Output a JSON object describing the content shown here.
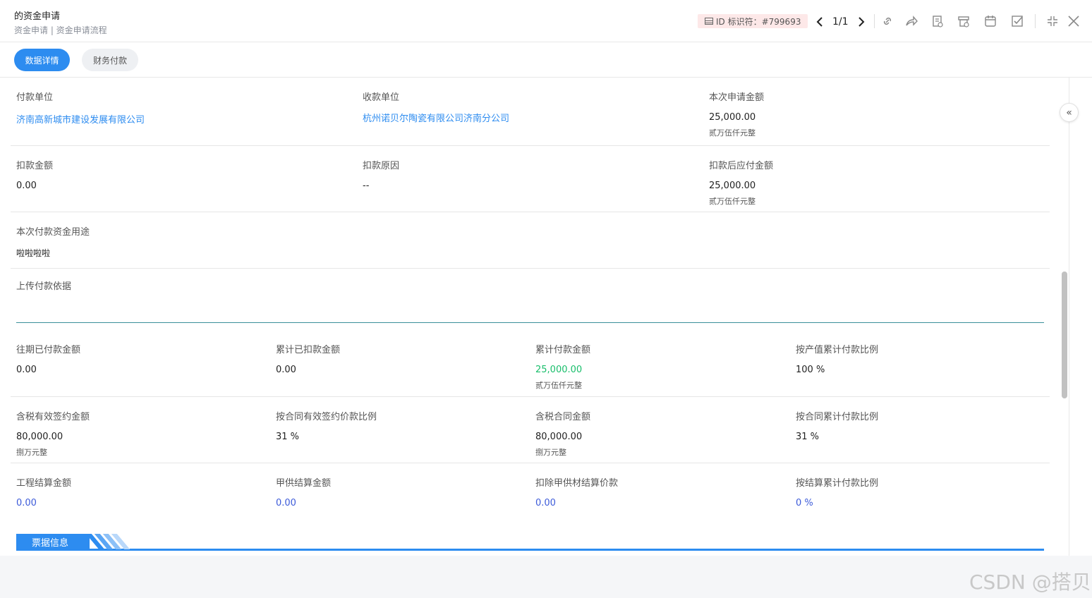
{
  "header": {
    "title": "的资金申请",
    "subtitle": "资金申请 | 资金申请流程",
    "id_label": "ID 标识符：#799693",
    "pager": "1/1"
  },
  "tabs": [
    {
      "label": "数据详情"
    },
    {
      "label": "财务付款"
    }
  ],
  "rows": {
    "r1": {
      "pay_unit_label": "付款单位",
      "pay_unit_value": "济南高新城市建设发展有限公司",
      "recv_unit_label": "收款单位",
      "recv_unit_value": "杭州诺贝尔陶瓷有限公司济南分公司",
      "apply_amount_label": "本次申请金额",
      "apply_amount_value": "25,000.00",
      "apply_amount_caption": "贰万伍仟元整"
    },
    "r2": {
      "deduct_label": "扣款金额",
      "deduct_value": "0.00",
      "reason_label": "扣款原因",
      "reason_value": "--",
      "after_label": "扣款后应付金额",
      "after_value": "25,000.00",
      "after_caption": "贰万伍仟元整"
    },
    "r3": {
      "purpose_label": "本次付款资金用途",
      "purpose_value": "啦啦啦啦"
    },
    "r4": {
      "upload_label": "上传付款依据"
    },
    "r5": {
      "c1_label": "往期已付款金额",
      "c1_value": "0.00",
      "c2_label": "累计已扣款金额",
      "c2_value": "0.00",
      "c3_label": "累计付款金额",
      "c3_value": "25,000.00",
      "c3_caption": "贰万伍仟元整",
      "c4_label": "按产值累计付款比例",
      "c4_value": "100 %"
    },
    "r6": {
      "c1_label": "含税有效签约金额",
      "c1_value": "80,000.00",
      "c1_caption": "捌万元整",
      "c2_label": "按合同有效签约价款比例",
      "c2_value": "31 %",
      "c3_label": "含税合同金额",
      "c3_value": "80,000.00",
      "c3_caption": "捌万元整",
      "c4_label": "按合同累计付款比例",
      "c4_value": "31 %"
    },
    "r7": {
      "c1_label": "工程结算金额",
      "c1_value": "0.00",
      "c2_label": "甲供结算金额",
      "c2_value": "0.00",
      "c3_label": "扣除甲供材结算价款",
      "c3_value": "0.00",
      "c4_label": "按结算累计付款比例",
      "c4_value": "0 %"
    }
  },
  "section": {
    "title": "票据信息"
  },
  "collapse_icon": "«",
  "watermark": "CSDN @搭贝",
  "colors": {
    "accent": "#2d8cf0",
    "green": "#19be6b",
    "link": "#2d8cf0",
    "id_badge_bg": "#fde8e8"
  }
}
